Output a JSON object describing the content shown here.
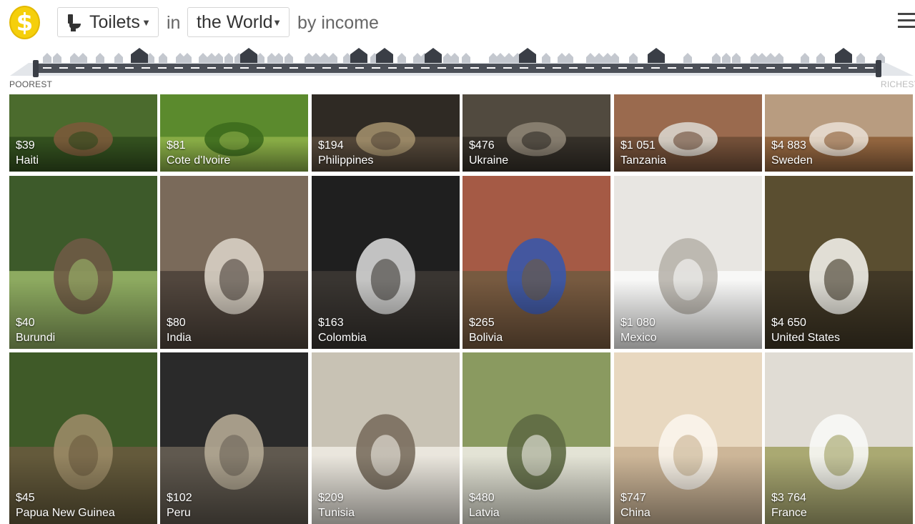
{
  "header": {
    "thing_label": "Toilets",
    "in_label": "in",
    "place_label": "the World",
    "by_label": "by income",
    "logo_symbol": "$"
  },
  "income_scale": {
    "poorest_label": "POOREST",
    "richest_label": "RICHEST"
  },
  "colors": {
    "logo": "#f5cf0b",
    "road": "#4c5058",
    "houses_light": "#c4c8cf",
    "houses_dark": "#3a3e46"
  },
  "cards": [
    {
      "income": "$39",
      "country": "Haiti"
    },
    {
      "income": "$81",
      "country": "Cote d'Ivoire"
    },
    {
      "income": "$194",
      "country": "Philippines"
    },
    {
      "income": "$476",
      "country": "Ukraine"
    },
    {
      "income": "$1 051",
      "country": "Tanzania"
    },
    {
      "income": "$4 883",
      "country": "Sweden"
    },
    {
      "income": "$40",
      "country": "Burundi"
    },
    {
      "income": "$80",
      "country": "India"
    },
    {
      "income": "$163",
      "country": "Colombia"
    },
    {
      "income": "$265",
      "country": "Bolivia"
    },
    {
      "income": "$1 080",
      "country": "Mexico"
    },
    {
      "income": "$4 650",
      "country": "United States"
    },
    {
      "income": "$45",
      "country": "Papua New Guinea"
    },
    {
      "income": "$102",
      "country": "Peru"
    },
    {
      "income": "$209",
      "country": "Tunisia"
    },
    {
      "income": "$480",
      "country": "Latvia"
    },
    {
      "income": "$747",
      "country": "China"
    },
    {
      "income": "$3 764",
      "country": "France"
    }
  ]
}
